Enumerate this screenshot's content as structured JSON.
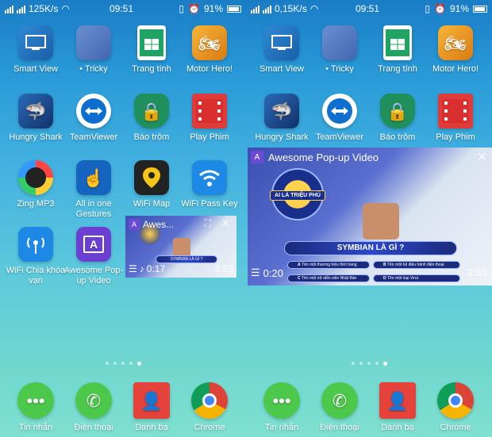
{
  "left": {
    "status": {
      "network": "125K/s",
      "time": "09:51",
      "battery": "91%"
    },
    "apps": [
      {
        "label": "Smart View",
        "icon": "smart-view-icon"
      },
      {
        "label": "Tricky",
        "icon": "tricky-icon"
      },
      {
        "label": "Trang tính",
        "icon": "sheets-icon"
      },
      {
        "label": "Motor Hero!",
        "icon": "motor-hero-icon"
      },
      {
        "label": "Hungry Shark",
        "icon": "hungry-shark-icon"
      },
      {
        "label": "TeamViewer",
        "icon": "teamviewer-icon"
      },
      {
        "label": "Báo trộm",
        "icon": "lock-icon"
      },
      {
        "label": "Play Phim",
        "icon": "film-icon"
      },
      {
        "label": "Zing MP3",
        "icon": "zing-mp3-icon"
      },
      {
        "label": "All in one Gestures",
        "icon": "gestures-icon"
      },
      {
        "label": "WiFi Map",
        "icon": "wifi-map-icon"
      },
      {
        "label": "WiFi Pass Key",
        "icon": "wifi-key-icon"
      },
      {
        "label": "WiFi Chia khóa vạn",
        "icon": "wifi-chia-icon"
      },
      {
        "label": "Awesome Pop-up Video",
        "icon": "awesome-popup-icon"
      }
    ],
    "popup": {
      "title": "Awes...",
      "elapsed": "0:17",
      "duration": "3:53",
      "question": "SYMBIAN LÀ GÌ ?"
    },
    "dock": [
      "Tin nhắn",
      "Điện thoại",
      "Danh bạ",
      "Chrome"
    ]
  },
  "right": {
    "status": {
      "network": "0,15K/s",
      "time": "09:51",
      "battery": "91%"
    },
    "apps": [
      {
        "label": "Smart View"
      },
      {
        "label": "Tricky"
      },
      {
        "label": "Trang tính"
      },
      {
        "label": "Motor Hero!"
      },
      {
        "label": "Hungry Shark"
      },
      {
        "label": "TeamViewer"
      },
      {
        "label": "Báo trộm"
      },
      {
        "label": "Play Phim"
      }
    ],
    "popup": {
      "title": "Awesome Pop-up Video",
      "logo": "AI LÀ TRIỆU PHÚ",
      "question": "SYMBIAN LÀ GÌ ?",
      "answers": [
        {
          "letter": "A",
          "text": "Tên một thương hiệu thời trang"
        },
        {
          "letter": "B",
          "text": "Tên một hệ điều hành điện thoại"
        },
        {
          "letter": "C",
          "text": "Tên một nữ diễn viên Nhật Bản"
        },
        {
          "letter": "D",
          "text": "Tên một loại Virut"
        }
      ],
      "elapsed": "0:20",
      "duration": "3:53"
    },
    "dock": [
      "Tin nhắn",
      "Điện thoại",
      "Danh bạ",
      "Chrome"
    ]
  }
}
